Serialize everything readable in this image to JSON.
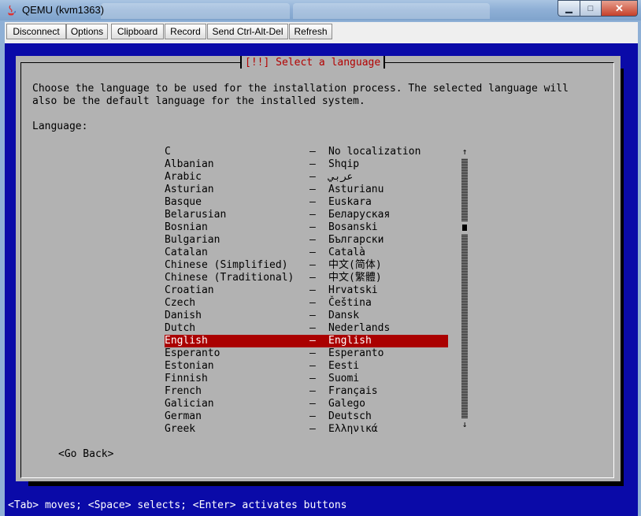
{
  "window": {
    "title": "QEMU (kvm1363)",
    "minimize_glyph": "▁",
    "maximize_glyph": "□",
    "close_glyph": "✕"
  },
  "toolbar": {
    "buttons": [
      "Disconnect",
      "Options",
      "Clipboard",
      "Record",
      "Send Ctrl-Alt-Del",
      "Refresh"
    ]
  },
  "dialog": {
    "title": "[!!] Select a language",
    "intro_line1": "Choose the language to be used for the installation process. The selected language will",
    "intro_line2": "also be the default language for the installed system.",
    "field_label": "Language:",
    "separator": "–",
    "languages": [
      {
        "name": "C",
        "native": "No localization"
      },
      {
        "name": "Albanian",
        "native": "Shqip"
      },
      {
        "name": "Arabic",
        "native": "عربي"
      },
      {
        "name": "Asturian",
        "native": "Asturianu"
      },
      {
        "name": "Basque",
        "native": "Euskara"
      },
      {
        "name": "Belarusian",
        "native": "Беларуская"
      },
      {
        "name": "Bosnian",
        "native": "Bosanski"
      },
      {
        "name": "Bulgarian",
        "native": "Български"
      },
      {
        "name": "Catalan",
        "native": "Català"
      },
      {
        "name": "Chinese (Simplified)",
        "native": "中文(简体)"
      },
      {
        "name": "Chinese (Traditional)",
        "native": "中文(繁體)"
      },
      {
        "name": "Croatian",
        "native": "Hrvatski"
      },
      {
        "name": "Czech",
        "native": "Čeština"
      },
      {
        "name": "Danish",
        "native": "Dansk"
      },
      {
        "name": "Dutch",
        "native": "Nederlands"
      },
      {
        "name": "English",
        "native": "English"
      },
      {
        "name": "Esperanto",
        "native": "Esperanto"
      },
      {
        "name": "Estonian",
        "native": "Eesti"
      },
      {
        "name": "Finnish",
        "native": "Suomi"
      },
      {
        "name": "French",
        "native": "Français"
      },
      {
        "name": "Galician",
        "native": "Galego"
      },
      {
        "name": "German",
        "native": "Deutsch"
      },
      {
        "name": "Greek",
        "native": "Ελληνικά"
      }
    ],
    "selected": "English",
    "scroll_up": "↑",
    "scroll_down": "↓",
    "go_back": "<Go Back>"
  },
  "status_bar": "<Tab> moves; <Space> selects; <Enter> activates buttons",
  "colors": {
    "console_bg": "#0a0aa8",
    "dialog_bg": "#b2b2b2",
    "highlight": "#aa0000",
    "title_text": "#b30000"
  }
}
